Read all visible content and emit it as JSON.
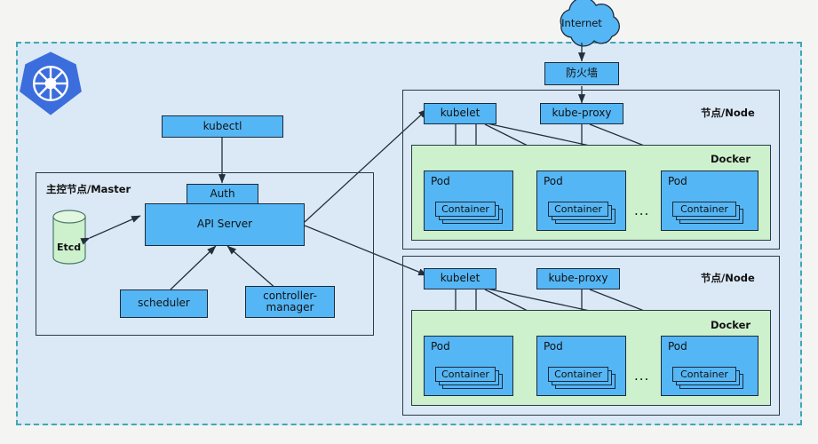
{
  "diagram": {
    "title": "Kubernetes Architecture",
    "colors": {
      "node_blue": "#55b6f5",
      "docker_green": "#cdf0cd",
      "cluster_bg": "#dbe8f5",
      "cluster_border": "#3fa8b4",
      "etcd_green": "#cdf0cd",
      "logo_blue": "#3b6edc",
      "outline": "#1b2a3a",
      "page_bg": "#f4f5f3"
    },
    "external": {
      "internet": "Internet",
      "firewall": "防火墙"
    },
    "logo_name": "kubernetes-logo",
    "kubectl": "kubectl",
    "master": {
      "label": "主控节点/Master",
      "auth": "Auth",
      "api_server": "API Server",
      "etcd": "Etcd",
      "scheduler": "scheduler",
      "controller_manager": "controller-\nmanager"
    },
    "nodes": [
      {
        "label": "节点/Node",
        "kubelet": "kubelet",
        "kube_proxy": "kube-proxy",
        "docker": "Docker",
        "ellipsis": "...",
        "pods": [
          {
            "label": "Pod",
            "container": "Container"
          },
          {
            "label": "Pod",
            "container": "Container"
          },
          {
            "label": "Pod",
            "container": "Container"
          }
        ]
      },
      {
        "label": "节点/Node",
        "kubelet": "kubelet",
        "kube_proxy": "kube-proxy",
        "docker": "Docker",
        "ellipsis": "...",
        "pods": [
          {
            "label": "Pod",
            "container": "Container"
          },
          {
            "label": "Pod",
            "container": "Container"
          },
          {
            "label": "Pod",
            "container": "Container"
          }
        ]
      }
    ]
  }
}
